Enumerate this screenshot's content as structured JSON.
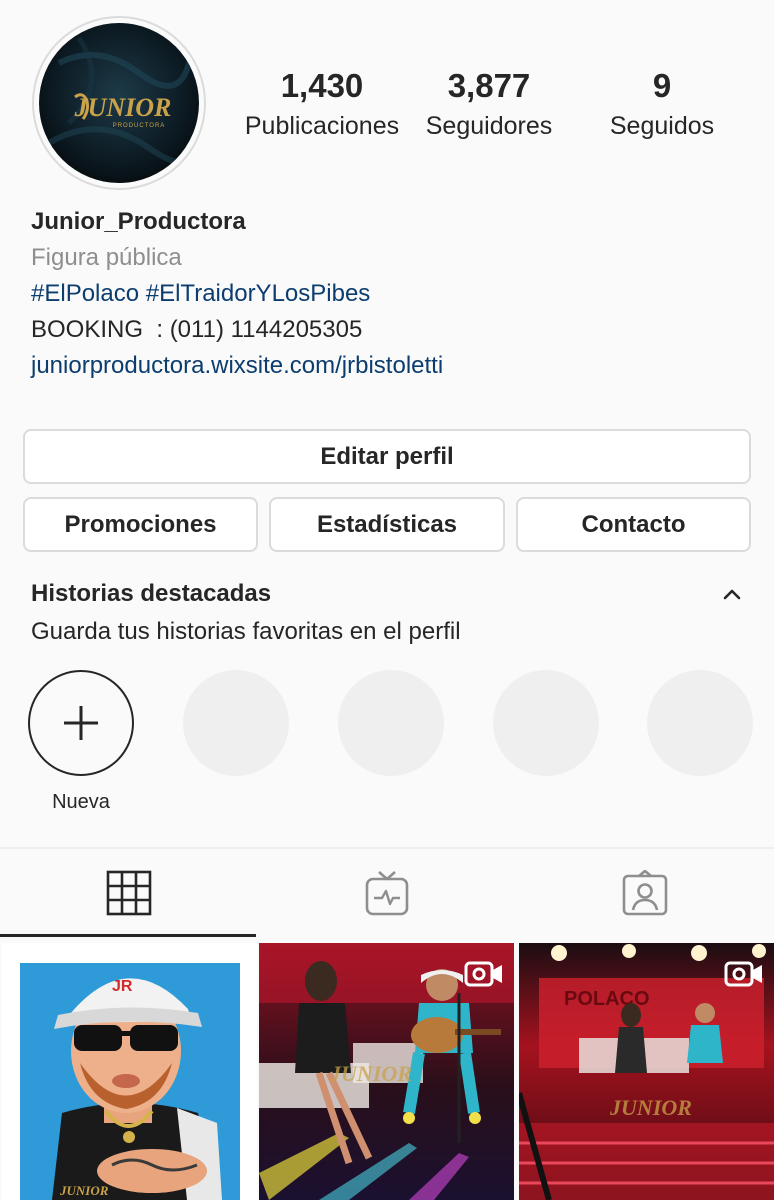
{
  "profile": {
    "username": "Junior_Productora",
    "logo_text": "JUNIOR",
    "logo_sub": "PRODUCTORA",
    "category": "Figura pública",
    "hashtags": "#ElPolaco #ElTraidorYLosPibes",
    "booking": "BOOKING  : (011) 1144205305",
    "website": "juniorproductora.wixsite.com/jrbistoletti"
  },
  "stats": [
    {
      "value": "1,430",
      "label": "Publicaciones"
    },
    {
      "value": "3,877",
      "label": "Seguidores"
    },
    {
      "value": "9",
      "label": "Seguidos"
    }
  ],
  "actions": {
    "edit_profile": "Editar perfil",
    "promotions": "Promociones",
    "insights": "Estadísticas",
    "contact": "Contacto"
  },
  "highlights": {
    "title": "Historias destacadas",
    "subtitle": "Guarda tus historias favoritas en el perfil",
    "new_label": "Nueva"
  },
  "tabs": [
    {
      "icon": "grid-icon",
      "active": true
    },
    {
      "icon": "igtv-icon",
      "active": false
    },
    {
      "icon": "tagged-icon",
      "active": false
    }
  ],
  "posts": [
    {
      "type": "image",
      "watermark": "JUNIOR"
    },
    {
      "type": "video",
      "watermark": "JUNIOR"
    },
    {
      "type": "video",
      "stage_text": "POLACO",
      "watermark": "JUNIOR"
    }
  ],
  "colors": {
    "text": "#262626",
    "muted": "#8e8e8e",
    "link": "#0b3d6e",
    "border": "#dbdbdb",
    "background": "#fafafa"
  }
}
